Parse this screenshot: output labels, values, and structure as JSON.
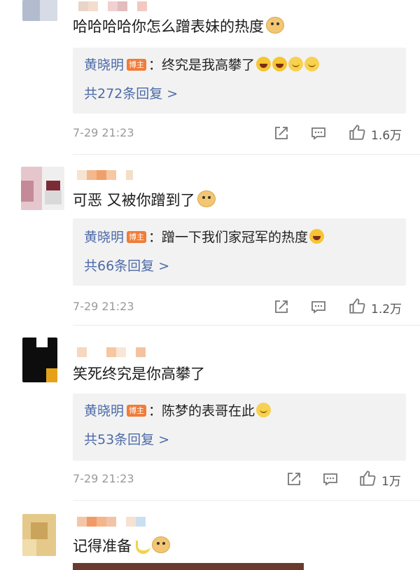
{
  "colors": {
    "author": "#4c6aa8",
    "badge": "#f07c38",
    "reply_bg": "#f2f2f2",
    "meta": "#9a9a9a"
  },
  "comments": [
    {
      "text": "哈哈哈哈你怎么蹭表妹的热度",
      "emoji": "doge-emoji",
      "reply": {
        "author": "黄晓明",
        "badge": "博主",
        "colon": "：",
        "text": "终究是我高攀了",
        "emojis": [
          "laugh-emoji",
          "laugh-emoji",
          "grin-emoji",
          "grin-emoji"
        ]
      },
      "more_replies": "共272条回复 >",
      "time": "7-29 21:23",
      "likes": "1.6万"
    },
    {
      "text": "可恶 又被你蹭到了",
      "emoji": "doge-emoji",
      "reply": {
        "author": "黄晓明",
        "badge": "博主",
        "colon": "：",
        "text": "蹭一下我们家冠军的热度",
        "emojis": [
          "laugh-emoji"
        ]
      },
      "more_replies": "共66条回复 >",
      "time": "7-29 21:23",
      "likes": "1.2万"
    },
    {
      "text": "笑死终究是你高攀了",
      "reply": {
        "author": "黄晓明",
        "badge": "博主",
        "colon": "：",
        "text": "陈梦的表哥在此",
        "emojis": [
          "grin-emoji"
        ]
      },
      "more_replies": "共53条回复 >",
      "time": "7-29 21:23",
      "likes": "1万"
    },
    {
      "text": "记得准备",
      "emojis": [
        "banana-emoji",
        "doge-emoji"
      ]
    }
  ]
}
